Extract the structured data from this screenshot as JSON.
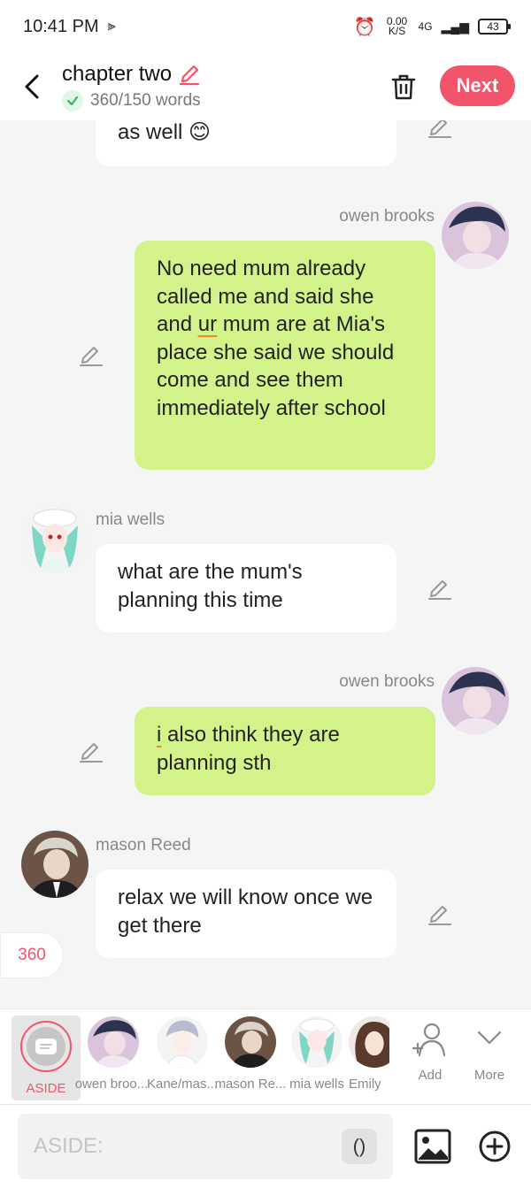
{
  "status": {
    "time": "10:41 PM",
    "net_speed": "0.00 K/S",
    "network": "4G",
    "battery": "43"
  },
  "header": {
    "title": "chapter two",
    "words": "360/150 words",
    "next_label": "Next"
  },
  "messages": [
    {
      "speaker": "",
      "text": "as well 😊"
    },
    {
      "speaker": "owen brooks",
      "text": "No need mum already called me and said she and ur mum are at Mia's place she said we should come and see them immediately after school"
    },
    {
      "speaker": "mia wells",
      "text": "what are the mum's planning this time"
    },
    {
      "speaker": "owen brooks",
      "text": "i also think they are planning sth"
    },
    {
      "speaker": "mason Reed",
      "text": "relax we will know once we get there"
    }
  ],
  "word_count_badge": "360",
  "characters": [
    {
      "label": "ASIDE"
    },
    {
      "label": "owen broo..."
    },
    {
      "label": "Kane/mas..."
    },
    {
      "label": "mason Re..."
    },
    {
      "label": "mia wells"
    },
    {
      "label": "Emily"
    }
  ],
  "actions": {
    "add_label": "Add",
    "more_label": "More"
  },
  "input": {
    "placeholder": "ASIDE:",
    "paren_label": "()"
  },
  "colors": {
    "accent": "#f2546b",
    "right_bubble": "#d4f28a",
    "left_bubble": "#ffffff"
  }
}
